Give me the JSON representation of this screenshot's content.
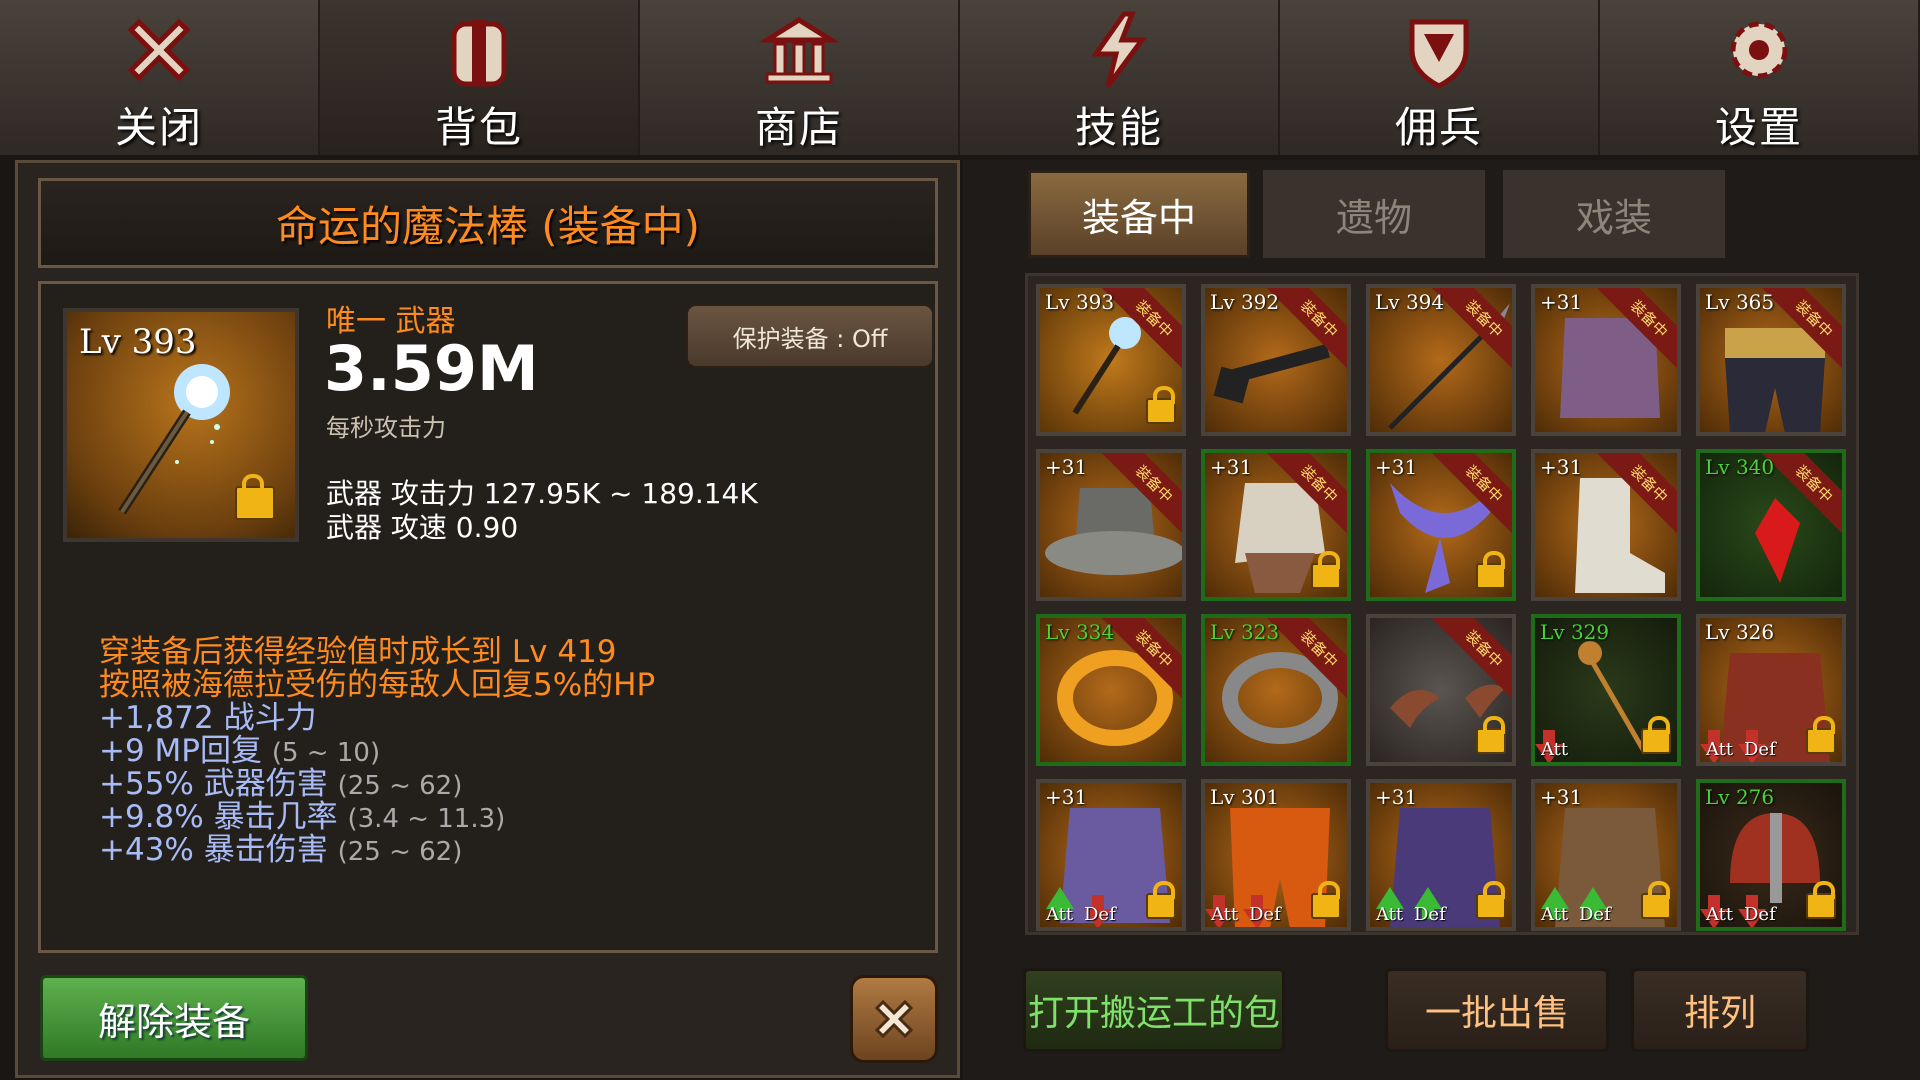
{
  "nav": {
    "tabs": [
      {
        "label": "关闭",
        "icon": "close-icon"
      },
      {
        "label": "背包",
        "icon": "backpack-icon"
      },
      {
        "label": "商店",
        "icon": "shop-icon"
      },
      {
        "label": "技能",
        "icon": "lightning-icon"
      },
      {
        "label": "佣兵",
        "icon": "shield-icon"
      },
      {
        "label": "设置",
        "icon": "gear-icon"
      }
    ]
  },
  "item": {
    "title": "命运的魔法棒 (装备中)",
    "level": "Lv 393",
    "rarity_type": "唯一 武器",
    "dps": "3.59M",
    "dps_label": "每秒攻击力",
    "protect": "保护装备 : Off",
    "weapon_attack": "武器 攻击力 127.95K ~ 189.14K",
    "weapon_speed": "武器 攻速 0.90",
    "bonuses": {
      "b1": "穿装备后获得经验值时成长到 Lv 419",
      "b2": "按照被海德拉受伤的每敌人回复5%的HP",
      "b3": "+1,872 战斗力",
      "b4": "+9 MP回复",
      "b4r": "(5 ~ 10)",
      "b5": "+55% 武器伤害",
      "b5r": "(25 ~ 62)",
      "b6": "+9.8% 暴击几率",
      "b6r": "(3.4 ~ 11.3)",
      "b7": "+43% 暴击伤害",
      "b7r": "(25 ~ 62)"
    },
    "unequip": "解除装备"
  },
  "inventory": {
    "subtabs": [
      "装备中",
      "遗物",
      "戏装"
    ],
    "equipped_ribbon": "装备中",
    "att": "Att",
    "def": "Def",
    "cells": [
      {
        "lv": "Lv 393"
      },
      {
        "lv": "Lv 392"
      },
      {
        "lv": "Lv 394"
      },
      {
        "lv": "+31"
      },
      {
        "lv": "Lv 365"
      },
      {
        "lv": "+31"
      },
      {
        "lv": "+31"
      },
      {
        "lv": "+31"
      },
      {
        "lv": "+31"
      },
      {
        "lv": "Lv 340"
      },
      {
        "lv": "Lv 334"
      },
      {
        "lv": "Lv 323"
      },
      {
        "lv": ""
      },
      {
        "lv": "Lv 329"
      },
      {
        "lv": "Lv 326"
      },
      {
        "lv": "+31"
      },
      {
        "lv": "Lv 301"
      },
      {
        "lv": "+31"
      },
      {
        "lv": "+31"
      },
      {
        "lv": "Lv 276"
      }
    ],
    "btn_porter": "打开搬运工的包",
    "btn_sell": "一批出售",
    "btn_sort": "排列"
  }
}
